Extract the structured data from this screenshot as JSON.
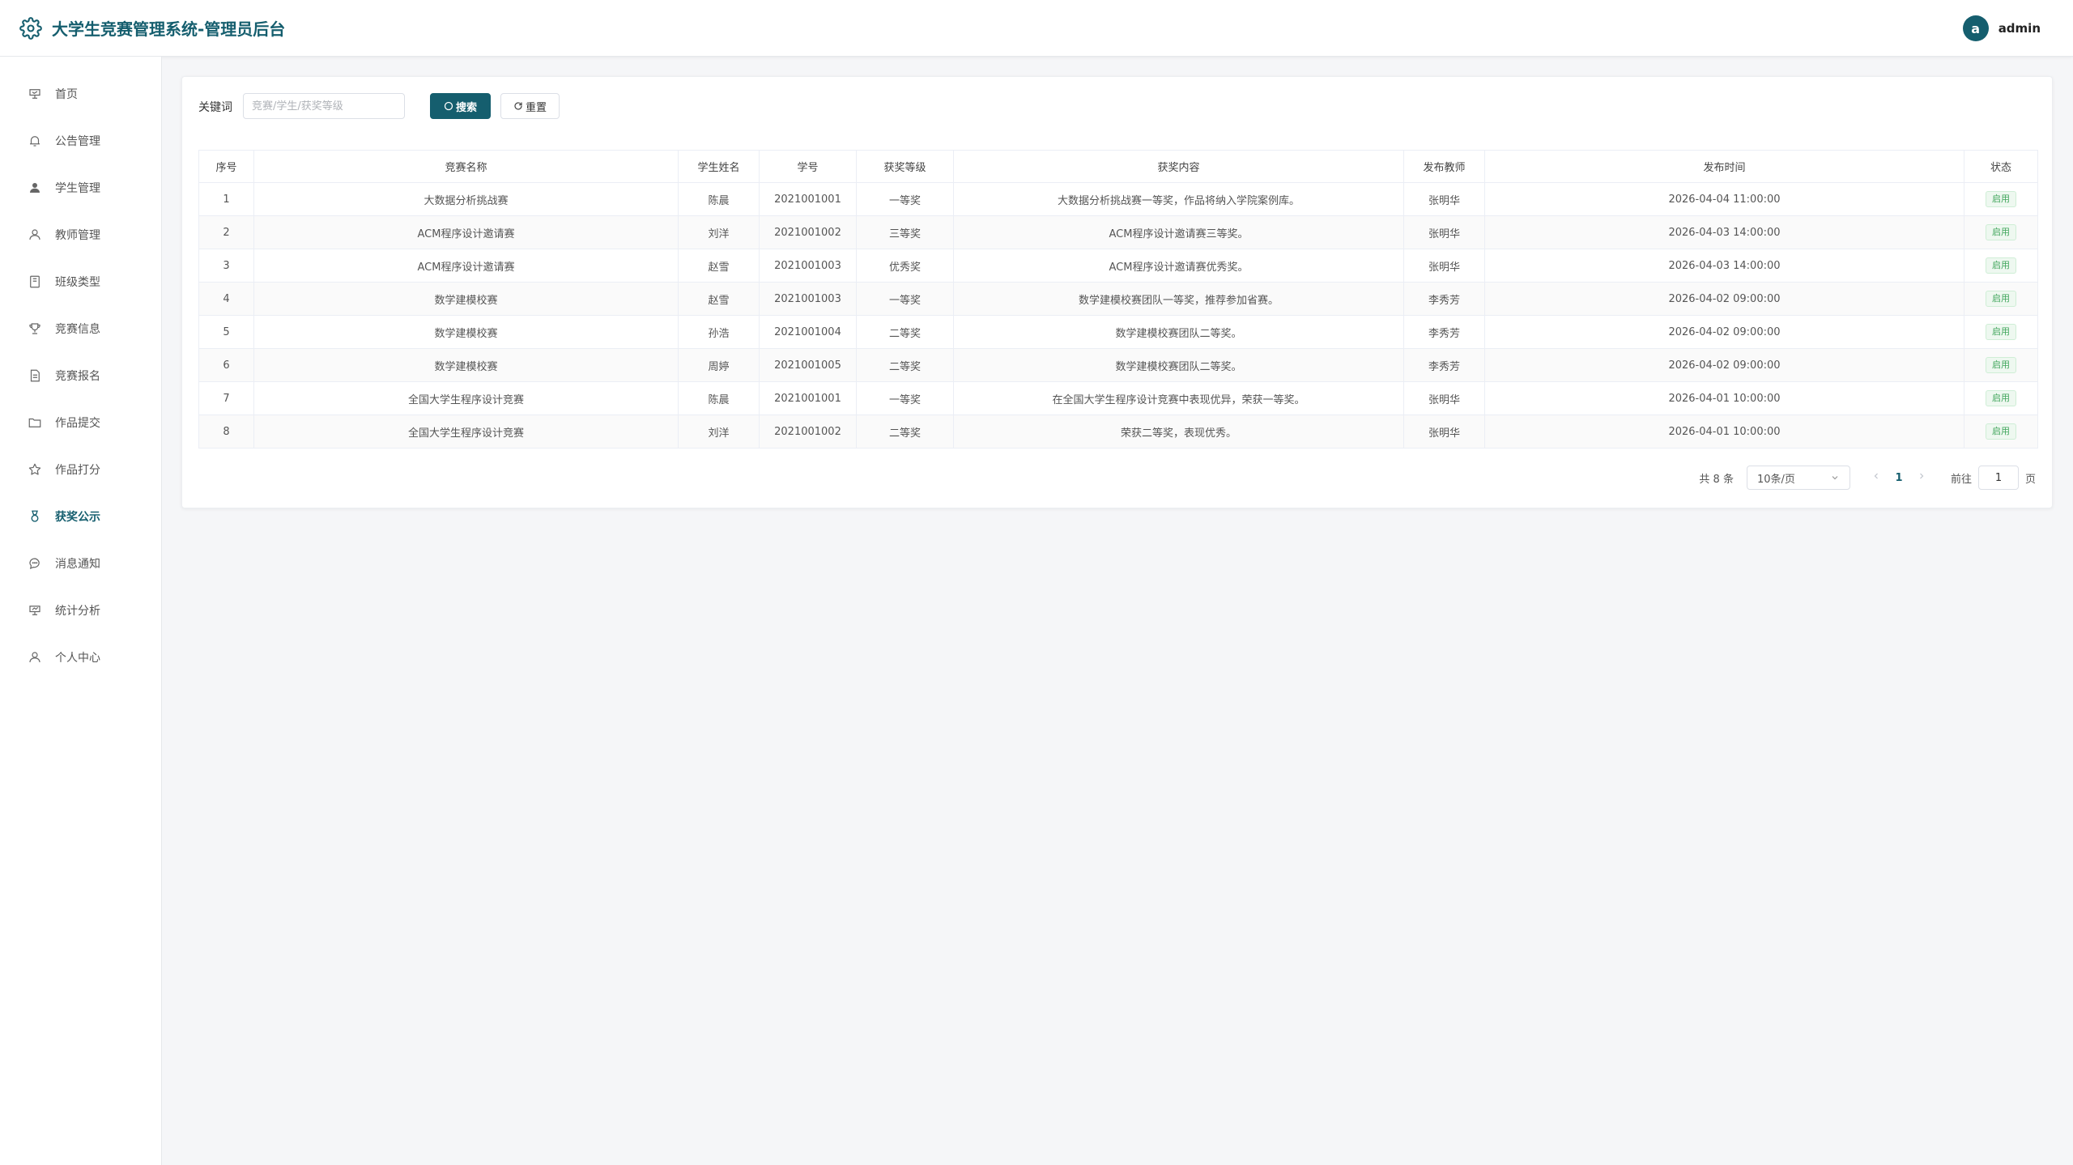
{
  "header": {
    "title": "大学生竞赛管理系统-管理员后台",
    "avatar_letter": "a",
    "username": "admin"
  },
  "sidebar": {
    "items": [
      {
        "label": "首页",
        "icon": "home-icon"
      },
      {
        "label": "公告管理",
        "icon": "bell-icon"
      },
      {
        "label": "学生管理",
        "icon": "user-filled-icon"
      },
      {
        "label": "教师管理",
        "icon": "user-icon"
      },
      {
        "label": "班级类型",
        "icon": "notebook-icon"
      },
      {
        "label": "竞赛信息",
        "icon": "trophy-icon"
      },
      {
        "label": "竞赛报名",
        "icon": "document-icon"
      },
      {
        "label": "作品提交",
        "icon": "folder-icon"
      },
      {
        "label": "作品打分",
        "icon": "star-icon"
      },
      {
        "label": "获奖公示",
        "icon": "medal-icon"
      },
      {
        "label": "消息通知",
        "icon": "chat-icon"
      },
      {
        "label": "统计分析",
        "icon": "chart-icon"
      },
      {
        "label": "个人中心",
        "icon": "user-icon"
      }
    ],
    "active_index": 9
  },
  "filter": {
    "keyword_label": "关键词",
    "keyword_placeholder": "竞赛/学生/获奖等级",
    "search_label": "搜索",
    "reset_label": "重置"
  },
  "table": {
    "columns": [
      "序号",
      "竞赛名称",
      "学生姓名",
      "学号",
      "获奖等级",
      "获奖内容",
      "发布教师",
      "发布时间",
      "状态"
    ],
    "rows": [
      [
        "1",
        "大数据分析挑战赛",
        "陈晨",
        "2021001001",
        "一等奖",
        "大数据分析挑战赛一等奖，作品将纳入学院案例库。",
        "张明华",
        "2026-04-04 11:00:00",
        "启用"
      ],
      [
        "2",
        "ACM程序设计邀请赛",
        "刘洋",
        "2021001002",
        "三等奖",
        "ACM程序设计邀请赛三等奖。",
        "张明华",
        "2026-04-03 14:00:00",
        "启用"
      ],
      [
        "3",
        "ACM程序设计邀请赛",
        "赵雪",
        "2021001003",
        "优秀奖",
        "ACM程序设计邀请赛优秀奖。",
        "张明华",
        "2026-04-03 14:00:00",
        "启用"
      ],
      [
        "4",
        "数学建模校赛",
        "赵雪",
        "2021001003",
        "一等奖",
        "数学建模校赛团队一等奖，推荐参加省赛。",
        "李秀芳",
        "2026-04-02 09:00:00",
        "启用"
      ],
      [
        "5",
        "数学建模校赛",
        "孙浩",
        "2021001004",
        "二等奖",
        "数学建模校赛团队二等奖。",
        "李秀芳",
        "2026-04-02 09:00:00",
        "启用"
      ],
      [
        "6",
        "数学建模校赛",
        "周婷",
        "2021001005",
        "二等奖",
        "数学建模校赛团队二等奖。",
        "李秀芳",
        "2026-04-02 09:00:00",
        "启用"
      ],
      [
        "7",
        "全国大学生程序设计竞赛",
        "陈晨",
        "2021001001",
        "一等奖",
        "在全国大学生程序设计竞赛中表现优异，荣获一等奖。",
        "张明华",
        "2026-04-01 10:00:00",
        "启用"
      ],
      [
        "8",
        "全国大学生程序设计竞赛",
        "刘洋",
        "2021001002",
        "二等奖",
        "荣获二等奖，表现优秀。",
        "张明华",
        "2026-04-01 10:00:00",
        "启用"
      ]
    ]
  },
  "pagination": {
    "total_text": "共 8 条",
    "page_size": "10条/页",
    "current_page": "1",
    "goto_label": "前往",
    "goto_value": "1",
    "goto_suffix": "页"
  },
  "colors": {
    "primary": "#155e6e",
    "status_tag": "#3fa55a"
  }
}
